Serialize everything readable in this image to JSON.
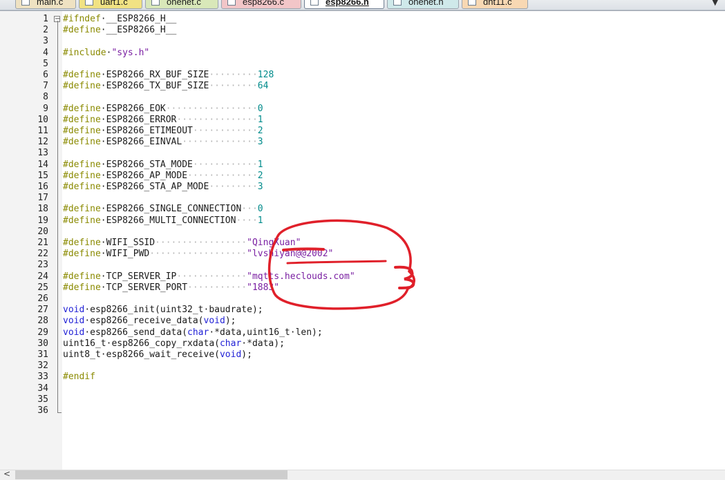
{
  "tabs": [
    {
      "label": "main.c",
      "color": "#efe2c2",
      "active": false
    },
    {
      "label": "uart1.c",
      "color": "#f1e283",
      "active": false
    },
    {
      "label": "onenet.c",
      "color": "#d9e8b9",
      "active": false
    },
    {
      "label": "esp8266.c",
      "color": "#f2c6c8",
      "active": false
    },
    {
      "label": "esp8266.h",
      "color": "#ffffff",
      "active": true
    },
    {
      "label": "onenet.h",
      "color": "#cfe9ea",
      "active": false
    },
    {
      "label": "dht11.c",
      "color": "#f8d8b3",
      "active": false
    }
  ],
  "tab_dropdown_glyph": "▼",
  "fold_toggle_glyph": "−",
  "scroll_left_glyph": "<",
  "code_lines": [
    {
      "n": "1",
      "t": [
        [
          "kw",
          "#ifndef"
        ],
        [
          "",
          "·__ESP8266_H__"
        ]
      ]
    },
    {
      "n": "2",
      "t": [
        [
          "kw",
          "#define"
        ],
        [
          "",
          "·__ESP8266_H__"
        ]
      ]
    },
    {
      "n": "3",
      "t": []
    },
    {
      "n": "4",
      "t": [
        [
          "kw",
          "#include"
        ],
        [
          "",
          "·"
        ],
        [
          "str",
          "\"sys.h\""
        ]
      ]
    },
    {
      "n": "5",
      "t": []
    },
    {
      "n": "6",
      "t": [
        [
          "kw",
          "#define"
        ],
        [
          "",
          "·ESP8266_RX_BUF_SIZE"
        ],
        [
          "dot",
          "·········"
        ],
        [
          "num",
          "128"
        ]
      ]
    },
    {
      "n": "7",
      "t": [
        [
          "kw",
          "#define"
        ],
        [
          "",
          "·ESP8266_TX_BUF_SIZE"
        ],
        [
          "dot",
          "·········"
        ],
        [
          "num",
          "64"
        ]
      ]
    },
    {
      "n": "8",
      "t": []
    },
    {
      "n": "9",
      "t": [
        [
          "kw",
          "#define"
        ],
        [
          "",
          "·ESP8266_EOK"
        ],
        [
          "dot",
          "·················"
        ],
        [
          "num",
          "0"
        ]
      ]
    },
    {
      "n": "10",
      "t": [
        [
          "kw",
          "#define"
        ],
        [
          "",
          "·ESP8266_ERROR"
        ],
        [
          "dot",
          "···············"
        ],
        [
          "num",
          "1"
        ]
      ]
    },
    {
      "n": "11",
      "t": [
        [
          "kw",
          "#define"
        ],
        [
          "",
          "·ESP8266_ETIMEOUT"
        ],
        [
          "dot",
          "············"
        ],
        [
          "num",
          "2"
        ]
      ]
    },
    {
      "n": "12",
      "t": [
        [
          "kw",
          "#define"
        ],
        [
          "",
          "·ESP8266_EINVAL"
        ],
        [
          "dot",
          "··············"
        ],
        [
          "num",
          "3"
        ]
      ]
    },
    {
      "n": "13",
      "t": []
    },
    {
      "n": "14",
      "t": [
        [
          "kw",
          "#define"
        ],
        [
          "",
          "·ESP8266_STA_MODE"
        ],
        [
          "dot",
          "············"
        ],
        [
          "num",
          "1"
        ]
      ]
    },
    {
      "n": "15",
      "t": [
        [
          "kw",
          "#define"
        ],
        [
          "",
          "·ESP8266_AP_MODE"
        ],
        [
          "dot",
          "·············"
        ],
        [
          "num",
          "2"
        ]
      ]
    },
    {
      "n": "16",
      "t": [
        [
          "kw",
          "#define"
        ],
        [
          "",
          "·ESP8266_STA_AP_MODE"
        ],
        [
          "dot",
          "·········"
        ],
        [
          "num",
          "3"
        ]
      ]
    },
    {
      "n": "17",
      "t": []
    },
    {
      "n": "18",
      "t": [
        [
          "kw",
          "#define"
        ],
        [
          "",
          "·ESP8266_SINGLE_CONNECTION"
        ],
        [
          "dot",
          "···"
        ],
        [
          "num",
          "0"
        ]
      ]
    },
    {
      "n": "19",
      "t": [
        [
          "kw",
          "#define"
        ],
        [
          "",
          "·ESP8266_MULTI_CONNECTION"
        ],
        [
          "dot",
          "····"
        ],
        [
          "num",
          "1"
        ]
      ]
    },
    {
      "n": "20",
      "t": []
    },
    {
      "n": "21",
      "t": [
        [
          "kw",
          "#define"
        ],
        [
          "",
          "·WIFI_SSID"
        ],
        [
          "dot",
          "·················"
        ],
        [
          "str",
          "\"QingXuan\""
        ]
      ]
    },
    {
      "n": "22",
      "t": [
        [
          "kw",
          "#define"
        ],
        [
          "",
          "·WIFI_PWD"
        ],
        [
          "dot",
          "··················"
        ],
        [
          "str",
          "\"lvshiyan@@2002\""
        ]
      ]
    },
    {
      "n": "23",
      "t": []
    },
    {
      "n": "24",
      "t": [
        [
          "kw",
          "#define"
        ],
        [
          "",
          "·TCP_SERVER_IP"
        ],
        [
          "dot",
          "·············"
        ],
        [
          "str",
          "\"mqtts.heclouds.com\""
        ]
      ]
    },
    {
      "n": "25",
      "t": [
        [
          "kw",
          "#define"
        ],
        [
          "",
          "·TCP_SERVER_PORT"
        ],
        [
          "dot",
          "···········"
        ],
        [
          "str",
          "\"1883\""
        ]
      ]
    },
    {
      "n": "26",
      "t": []
    },
    {
      "n": "27",
      "t": [
        [
          "ty",
          "void"
        ],
        [
          "",
          "·esp8266_init(uint32_t·baudrate);"
        ]
      ]
    },
    {
      "n": "28",
      "t": [
        [
          "ty",
          "void"
        ],
        [
          "",
          "·esp8266_receive_data("
        ],
        [
          "ty",
          "void"
        ],
        [
          "",
          ");"
        ]
      ]
    },
    {
      "n": "29",
      "t": [
        [
          "ty",
          "void"
        ],
        [
          "",
          "·esp8266_send_data("
        ],
        [
          "ty",
          "char"
        ],
        [
          "",
          "·*data,uint16_t·len);"
        ]
      ]
    },
    {
      "n": "30",
      "t": [
        [
          "",
          "uint16_t·esp8266_copy_rxdata("
        ],
        [
          "ty",
          "char"
        ],
        [
          "",
          "·*data);"
        ]
      ]
    },
    {
      "n": "31",
      "t": [
        [
          "",
          "uint8_t·esp8266_wait_receive("
        ],
        [
          "ty",
          "void"
        ],
        [
          "",
          ");"
        ]
      ]
    },
    {
      "n": "32",
      "t": []
    },
    {
      "n": "33",
      "t": [
        [
          "kw",
          "#endif"
        ]
      ]
    },
    {
      "n": "34",
      "t": []
    },
    {
      "n": "35",
      "t": []
    },
    {
      "n": "36",
      "t": []
    }
  ],
  "colors": {
    "keyword": "#8a8a00",
    "type": "#2222d6",
    "number": "#008b8b",
    "string": "#7a1fa2",
    "annotation": "#e0202a"
  }
}
